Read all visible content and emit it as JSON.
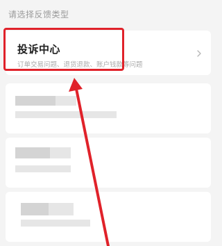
{
  "header": {
    "section_label": "请选择反馈类型"
  },
  "options": [
    {
      "title": "投诉中心",
      "description": "订单交易问题、退货退款、账户钱款等问题",
      "icon": "chevron-right-icon"
    }
  ],
  "annotation": {
    "color": "#e0222a"
  }
}
